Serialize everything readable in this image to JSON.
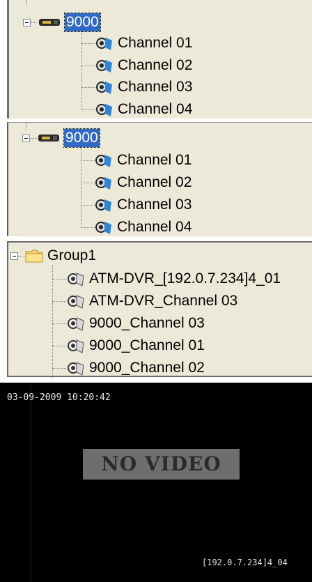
{
  "tree_a": {
    "device_label": "9000",
    "channels": [
      "Channel 01",
      "Channel 02",
      "Channel 03",
      "Channel 04"
    ]
  },
  "tree_b": {
    "device_label": "9000",
    "channels": [
      "Channel 01",
      "Channel 02",
      "Channel 03",
      "Channel 04"
    ]
  },
  "group_tree": {
    "group_label": "Group1",
    "items": [
      "ATM-DVR_[192.0.7.234]4_01",
      "ATM-DVR_Channel 03",
      "9000_Channel 03",
      "9000_Channel 01",
      "9000_Channel 02"
    ]
  },
  "video": {
    "timestamp": "03-09-2009 10:20:42",
    "status": "NO VIDEO",
    "channel_osd": "[192.0.7.234]4_04"
  }
}
